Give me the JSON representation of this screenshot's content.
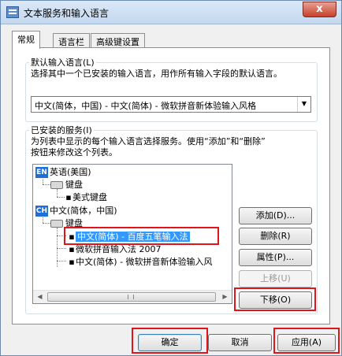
{
  "window": {
    "title": "文本服务和输入语言",
    "close_glyph": "x"
  },
  "tabs": [
    {
      "label": "常规"
    },
    {
      "label": "语言栏"
    },
    {
      "label": "高级键设置"
    }
  ],
  "default_input": {
    "group_label": "默认输入语言(L)",
    "description": "选择其中一个已安装的输入语言，用作所有输入字段的默认语言。",
    "selected_value": "中文(简体，中国) - 中文(简体) - 微软拼音新体验输入风格",
    "arrow_glyph": "▼"
  },
  "installed": {
    "group_label": "已安装的服务(I)",
    "description_line1": "为列表中显示的每个输入语言选择服务。使用“添加”和“删除”",
    "description_line2": "按钮来修改这个列表。",
    "tree": {
      "lang1_badge": "EN",
      "lang1_name": "英语(美国)",
      "lang1_keyboard": "键盘",
      "lang1_kb_item": "美式键盘",
      "lang2_badge": "CH",
      "lang2_name": "中文(简体，中国)",
      "lang2_keyboard": "键盘",
      "items": [
        "中文(简体) - 百度五笔输入法",
        "微软拼音输入法 2007",
        "中文(简体) - 微软拼音新体验输入风"
      ]
    },
    "scroll_left": "◀",
    "scroll_right": "▶"
  },
  "side_buttons": {
    "add": "添加(D)...",
    "remove": "删除(R)",
    "properties": "属性(P)...",
    "move_up": "上移(U)",
    "move_down": "下移(O)"
  },
  "footer": {
    "ok": "确定",
    "cancel": "取消",
    "apply": "应用(A)"
  },
  "colors": {
    "selection": "#3399ff",
    "annotation_red": "#e1141b",
    "lang_badge": "#1f6fd6"
  }
}
